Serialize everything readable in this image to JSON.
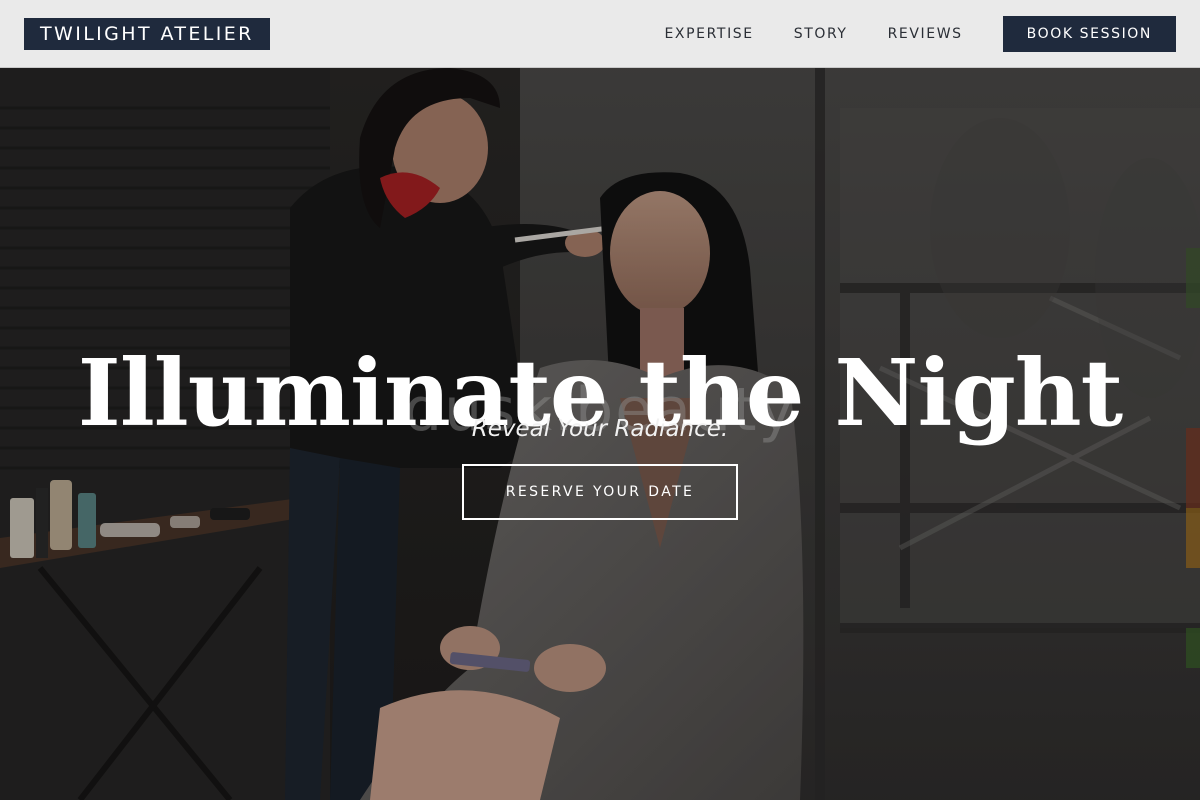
{
  "header": {
    "logo_text": "TWILIGHT ATELIER",
    "nav": [
      {
        "label": "EXPERTISE"
      },
      {
        "label": "STORY"
      },
      {
        "label": "REVIEWS"
      }
    ],
    "cta_label": "BOOK SESSION"
  },
  "hero": {
    "headline": "Illuminate the Night",
    "watermark": "dusk.beauty",
    "tagline": "Reveal Your Radiance.",
    "cta_label": "RESERVE YOUR DATE"
  },
  "colors": {
    "nav_background": "#eaeaea",
    "brand_navy": "#1f2a3d",
    "hero_text": "#ffffff"
  }
}
